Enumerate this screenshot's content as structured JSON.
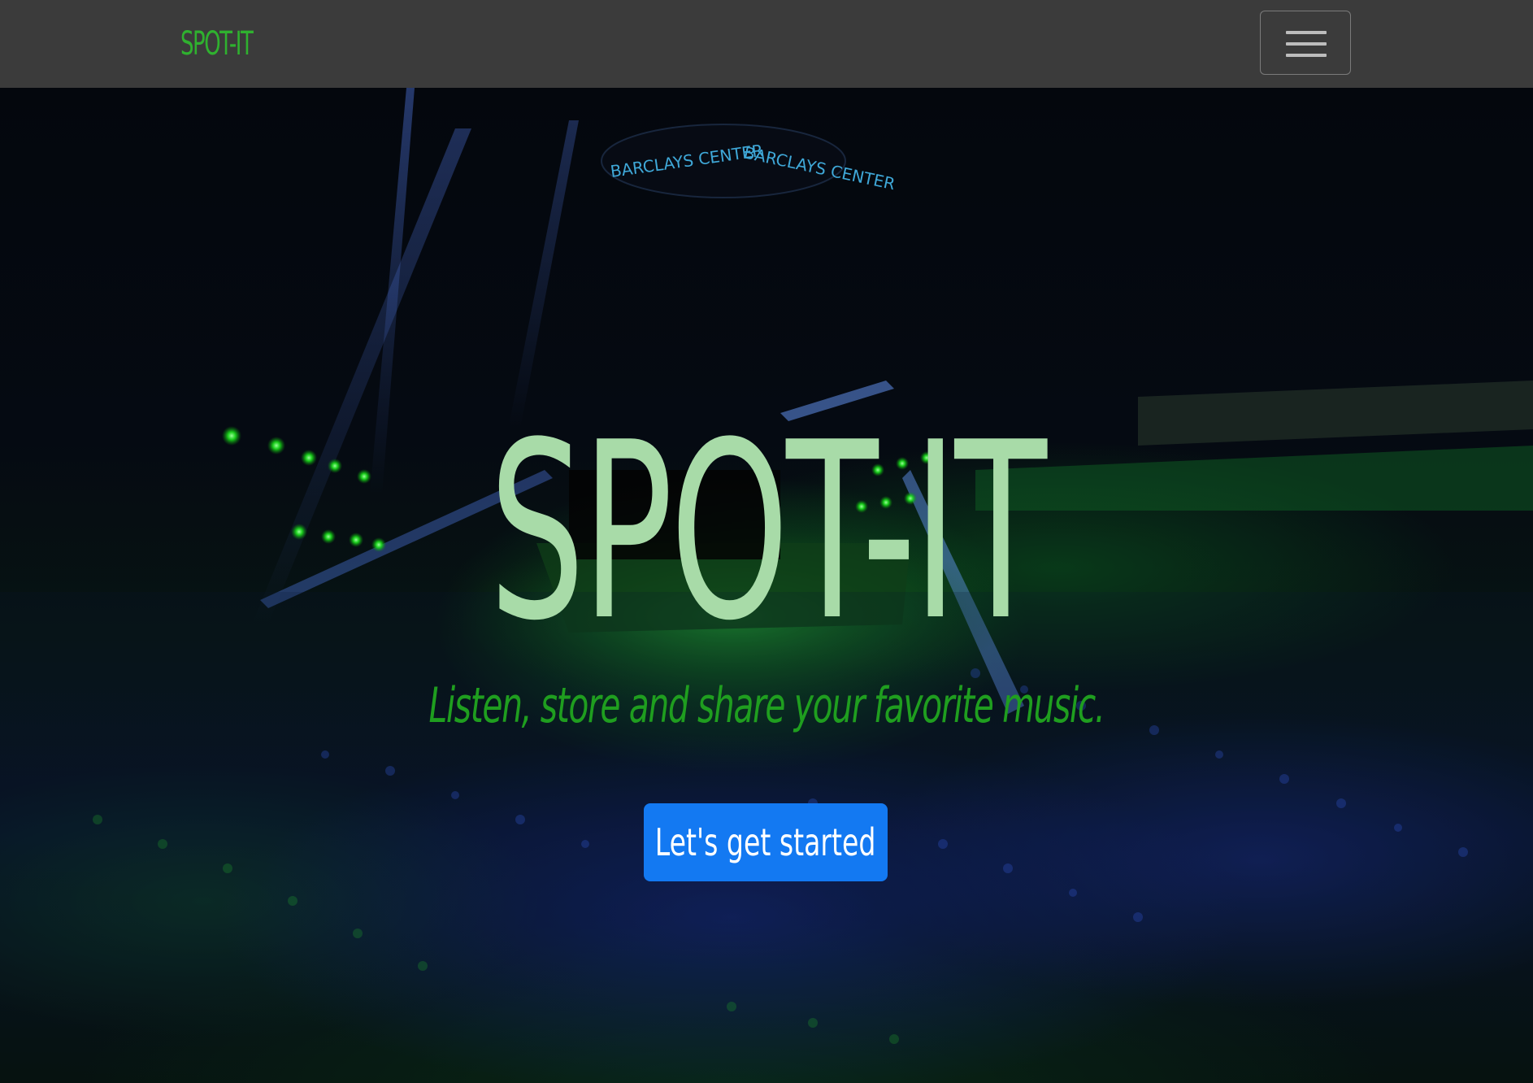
{
  "navbar": {
    "brand": "SPOT-IT",
    "toggler_icon": "hamburger-menu-icon"
  },
  "hero": {
    "title": "SPOT-IT",
    "subtitle": "Listen, store and share your favorite music.",
    "cta_label": "Let's get started",
    "background_image": "arena-concert-photo",
    "background_signage": [
      "BARCLAYS CENTER",
      "BARCLAYS CENTER"
    ]
  },
  "colors": {
    "navbar_bg": "#3b3b3b",
    "brand": "#2fb12f",
    "title": "#a8dba8",
    "subtitle": "#1f9e1f",
    "cta_bg": "#1379f2",
    "cta_text": "#ffffff"
  }
}
